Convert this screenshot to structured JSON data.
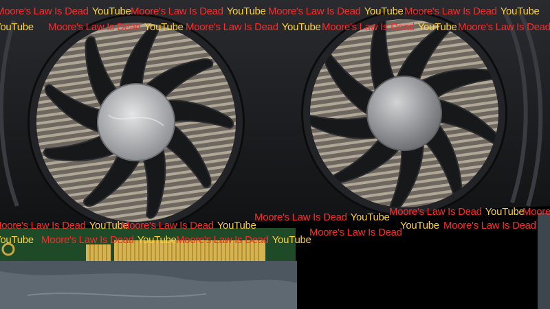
{
  "watermark": {
    "brand": "Moore's Law Is Dead",
    "platform": "YouTube",
    "brand_color": "#ff2a2a",
    "platform_color": "#ffd23a"
  },
  "scene": {
    "fan_count": 2,
    "colors": {
      "shroud": "#1c1d20",
      "fan_blade": "#17181a",
      "heatsink": "#8d857a",
      "hub_left": "#bdbfc2",
      "hub_right": "#a6a7aa",
      "pcb": "#1e4a28",
      "pcie_gold": "#d6b34e",
      "backdrop": "#000000"
    }
  }
}
